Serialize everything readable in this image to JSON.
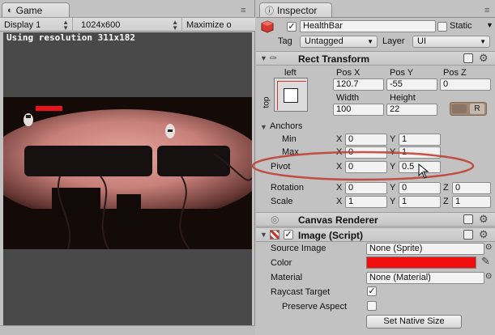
{
  "game": {
    "tab_label": "Game",
    "display_label": "Display 1",
    "resolution_dropdown": "1024x600",
    "maximize_label": "Maximize o",
    "resolution_text": "Using resolution 311x182"
  },
  "inspector": {
    "tab_label": "Inspector",
    "object_name": "HealthBar",
    "static_label": "Static",
    "tag_label": "Tag",
    "tag_value": "Untagged",
    "layer_label": "Layer",
    "layer_value": "UI"
  },
  "rect_transform": {
    "title": "Rect Transform",
    "anchor_preset_h": "left",
    "anchor_preset_v": "top",
    "col_labels": [
      "Pos X",
      "Pos Y",
      "Pos Z"
    ],
    "pos_x": "120.7",
    "pos_y": "-55",
    "pos_z": "0",
    "width_label": "Width",
    "height_label": "Height",
    "width": "100",
    "height": "22",
    "raw_btn": "R",
    "anchors_label": "Anchors",
    "min_label": "Min",
    "min_x": "0",
    "min_y": "1",
    "max_label": "Max",
    "max_x": "0",
    "max_y": "1",
    "pivot_label": "Pivot",
    "pivot_x": "0",
    "pivot_y": "0.5",
    "rotation_label": "Rotation",
    "rot_x": "0",
    "rot_y": "0",
    "rot_z": "0",
    "scale_label": "Scale",
    "scale_x": "1",
    "scale_y": "1",
    "scale_z": "1",
    "axis_x": "X",
    "axis_y": "Y",
    "axis_z": "Z"
  },
  "canvas_renderer": {
    "title": "Canvas Renderer"
  },
  "image_script": {
    "title": "Image (Script)",
    "source_image_label": "Source Image",
    "source_image_value": "None (Sprite)",
    "color_label": "Color",
    "color_value": "#f00d0d",
    "material_label": "Material",
    "material_value": "None (Material)",
    "raycast_label": "Raycast Target",
    "raycast_checked": true,
    "preserve_label": "Preserve Aspect",
    "preserve_checked": false,
    "native_size_btn": "Set Native Size"
  },
  "colors": {
    "health_bar": "#e8141a",
    "highlight_ellipse": "#c0392b",
    "viewport_bg": "#494949",
    "scene_dark": "#140b09",
    "scene_pink": "#c8807a"
  },
  "icons": [
    "game-tab-icon",
    "inspector-tab-icon",
    "gameobject-cube-icon",
    "help-book-icon",
    "gear-icon",
    "color-picker-icon",
    "object-picker-icon",
    "mouse-cursor-icon"
  ]
}
